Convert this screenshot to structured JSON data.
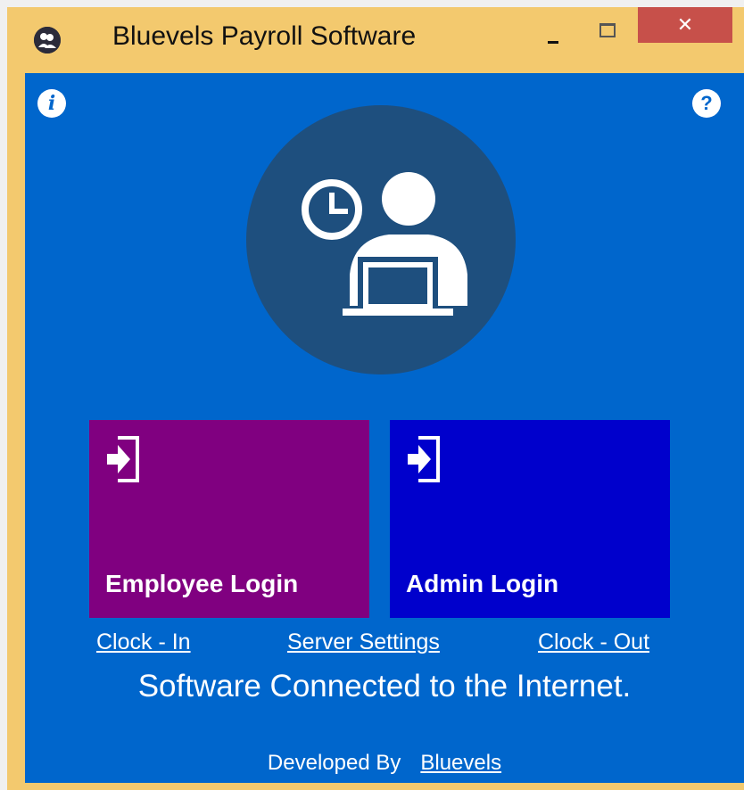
{
  "window": {
    "title": "Bluevels Payroll Software",
    "close_symbol": "✕",
    "icons": [
      "app-user-icon",
      "minimize-icon",
      "maximize-icon",
      "close-icon"
    ]
  },
  "content": {
    "info_symbol": "i",
    "help_symbol": "?",
    "hero_icon": "user-clock-laptop-icon"
  },
  "tiles": {
    "employee_label": "Employee Login",
    "admin_label": "Admin Login",
    "icon": "login-icon"
  },
  "links": {
    "clock_in": "Clock - In",
    "server_settings": "Server Settings",
    "clock_out": "Clock - Out"
  },
  "status": "Software Connected to the Internet.",
  "footer": {
    "prefix": "Developed By",
    "link": "Bluevels"
  },
  "colors": {
    "window_frame": "#f3c96e",
    "content_bg": "#0066cc",
    "hero_circle": "#1e4f7e",
    "employee_tile": "#800080",
    "admin_tile": "#0000cc",
    "close_button": "#c7504a"
  }
}
